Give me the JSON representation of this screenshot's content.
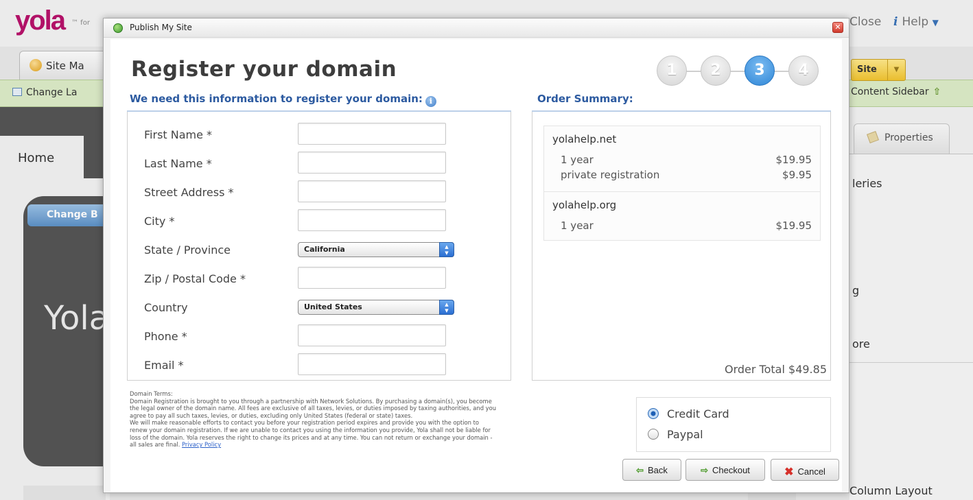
{
  "background": {
    "logo": "yola",
    "logo_small": "™ for",
    "tab_site_manager": "Site Ma",
    "toolbar_change_layout": "Change La",
    "home_tab": "Home",
    "change_button": "Change B",
    "site_title": "Yola",
    "close_link": "Close",
    "help_link": "Help",
    "site_button": "Site",
    "content_sidebar": "Content Sidebar",
    "properties_tab": "Properties",
    "sidebar_items": [
      "leries",
      "g",
      "ore"
    ],
    "column_layout": "Column Layout"
  },
  "dialog": {
    "title": "Publish My Site",
    "heading": "Register your domain",
    "steps": [
      "1",
      "2",
      "3",
      "4"
    ],
    "active_step": 3,
    "form_heading": "We need this information to register your domain:",
    "summary_heading": "Order Summary:",
    "fields": {
      "first_name": {
        "label": "First Name *",
        "value": ""
      },
      "last_name": {
        "label": "Last Name *",
        "value": ""
      },
      "street": {
        "label": "Street Address *",
        "value": ""
      },
      "city": {
        "label": "City *",
        "value": ""
      },
      "state": {
        "label": "State / Province",
        "value": "California"
      },
      "zip": {
        "label": "Zip / Postal Code *",
        "value": ""
      },
      "country": {
        "label": "Country",
        "value": "United States"
      },
      "phone": {
        "label": "Phone *",
        "value": ""
      },
      "email": {
        "label": "Email *",
        "value": ""
      }
    },
    "order": {
      "items": [
        {
          "domain": "yolahelp.net",
          "lines": [
            {
              "desc": "1 year",
              "price": "$19.95"
            },
            {
              "desc": "private registration",
              "price": "$9.95"
            }
          ]
        },
        {
          "domain": "yolahelp.org",
          "lines": [
            {
              "desc": "1 year",
              "price": "$19.95"
            }
          ]
        }
      ],
      "total": "Order Total $49.85"
    },
    "terms": {
      "lines": [
        "Domain Terms:",
        "Domain Registration is brought to you through a partnership with Network Solutions. By purchasing a domain(s), you become",
        "the legal owner of the domain name. All fees are exclusive of all taxes, levies, or duties imposed by taxing authorities, and you",
        "agree to pay all such taxes, levies, or duties, excluding only United States (federal or state) taxes.",
        "We will make reasonable efforts to contact you before your registration period expires and provide you with the option to",
        "renew your domain registration. If we are unable to contact you using the information you provide, Yola shall not be liable for",
        "loss of the domain. Yola reserves the right to change its prices and at any time. You can not return or exchange your domain -"
      ],
      "last_line": "all sales are final.",
      "privacy_link": "Privacy Policy"
    },
    "payment": {
      "options": [
        "Credit Card",
        "Paypal"
      ],
      "selected": "Credit Card"
    },
    "buttons": {
      "back": "Back",
      "checkout": "Checkout",
      "cancel": "Cancel"
    }
  }
}
